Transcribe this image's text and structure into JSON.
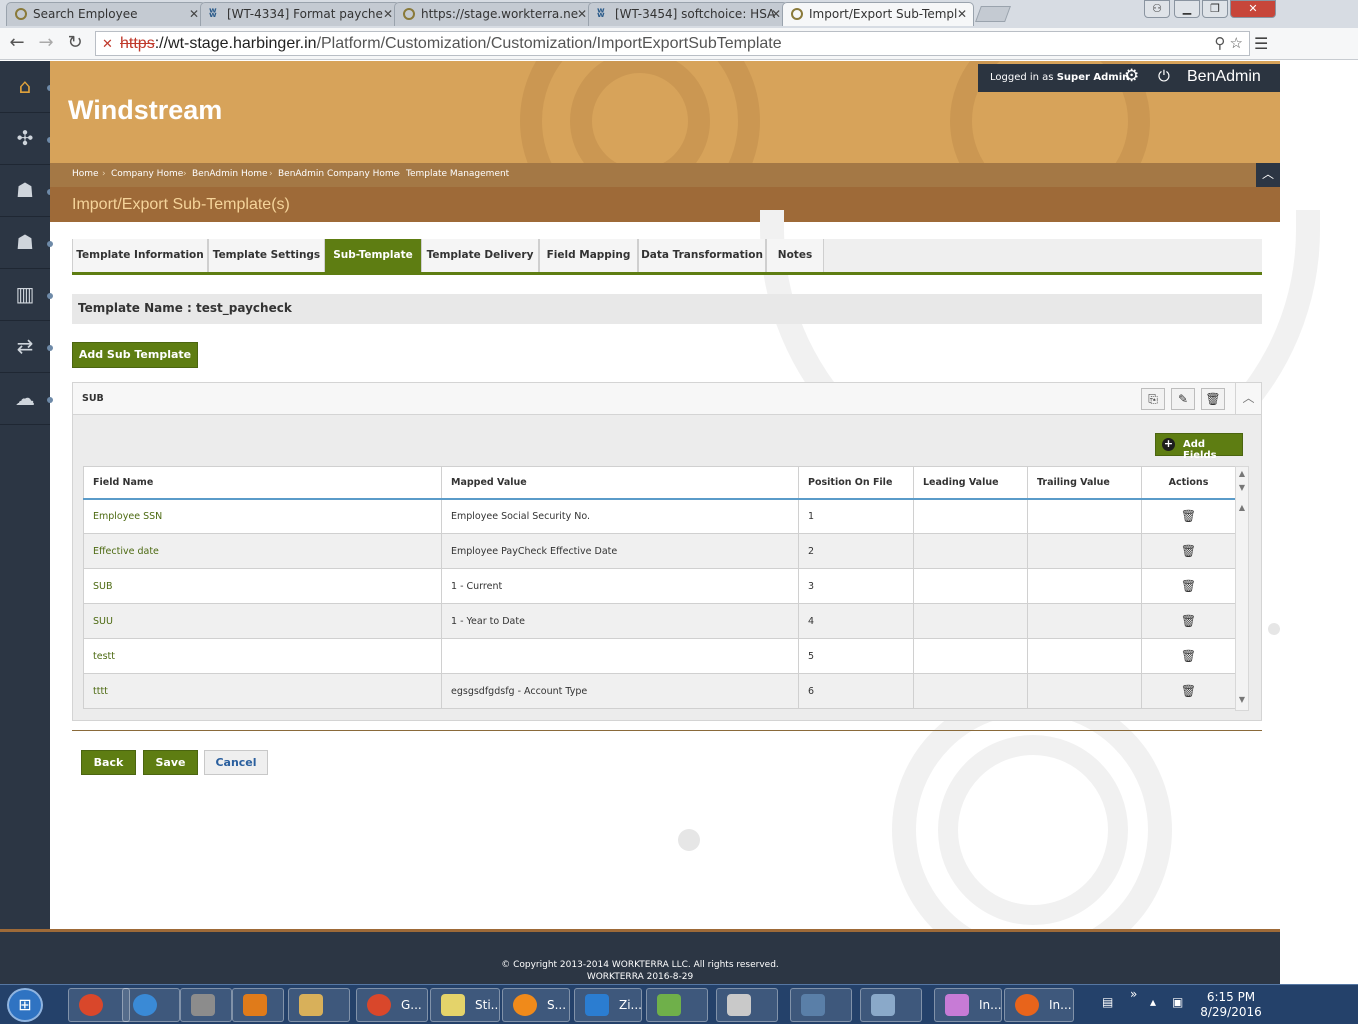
{
  "browser": {
    "tabs": [
      {
        "label": "Search Employee",
        "icon": "page-icon"
      },
      {
        "label": "[WT-4334] Format payche",
        "icon": "jira-icon"
      },
      {
        "label": "https://stage.workterra.ne",
        "icon": "page-icon"
      },
      {
        "label": "[WT-3454] softchoice: HSA",
        "icon": "jira-icon"
      },
      {
        "label": "Import/Export Sub-Templ",
        "icon": "page-icon"
      }
    ],
    "url_scheme": "https",
    "url_host": "://wt-stage.harbinger.in",
    "url_path": "/Platform/Customization/Customization/ImportExportSubTemplate"
  },
  "header": {
    "brand": "Windstream",
    "logged_in_prefix": "Logged in as",
    "logged_in_role": "Super Admin",
    "app_name": "BenAdmin",
    "accent_color": "#9e6a38"
  },
  "breadcrumb": [
    "Home",
    "Company Home",
    "BenAdmin Home",
    "BenAdmin Company Home",
    "Template Management"
  ],
  "page_title": "Import/Export Sub-Template(s)",
  "tabs": [
    {
      "label": "Template Information",
      "active": false
    },
    {
      "label": "Template Settings",
      "active": false
    },
    {
      "label": "Sub-Template",
      "active": true
    },
    {
      "label": "Template Delivery",
      "active": false
    },
    {
      "label": "Field Mapping",
      "active": false
    },
    {
      "label": "Data Transformation",
      "active": false
    },
    {
      "label": "Notes",
      "active": false
    }
  ],
  "template_name_label": "Template Name : test_paycheck",
  "add_sub_template_label": "Add Sub Template",
  "panel": {
    "title": "SUB",
    "add_fields_label": "Add Fields",
    "columns": [
      "Field Name",
      "Mapped Value",
      "Position On File",
      "Leading Value",
      "Trailing Value",
      "Actions"
    ],
    "rows": [
      {
        "field": "Employee SSN",
        "mapped": "Employee Social Security No.",
        "position": "1",
        "leading": "",
        "trailing": ""
      },
      {
        "field": "Effective date",
        "mapped": "Employee PayCheck Effective Date",
        "position": "2",
        "leading": "",
        "trailing": ""
      },
      {
        "field": "SUB",
        "mapped": "1 - Current",
        "position": "3",
        "leading": "",
        "trailing": ""
      },
      {
        "field": "SUU",
        "mapped": "1 - Year to Date",
        "position": "4",
        "leading": "",
        "trailing": ""
      },
      {
        "field": "testt",
        "mapped": "",
        "position": "5",
        "leading": "",
        "trailing": ""
      },
      {
        "field": "tttt",
        "mapped": "egsgsdfgdsfg - Account Type",
        "position": "6",
        "leading": "",
        "trailing": ""
      }
    ]
  },
  "actions": {
    "back": "Back",
    "save": "Save",
    "cancel": "Cancel"
  },
  "footer": {
    "copyright": "© Copyright 2013-2014 WORKTERRA LLC. All rights reserved.",
    "build": "WORKTERRA 2016-8-29"
  },
  "taskbar": {
    "apps": [
      {
        "label": "",
        "color": "#d9472b"
      },
      {
        "label": "",
        "color": "#3a8ad6"
      },
      {
        "label": "",
        "color": "#8c8c8c"
      },
      {
        "label": "",
        "color": "#e07b1a"
      },
      {
        "label": "",
        "color": "#d8b05a"
      },
      {
        "label": "G...",
        "color": "#d9472b"
      },
      {
        "label": "Sti...",
        "color": "#e4d36a"
      },
      {
        "label": "S...",
        "color": "#f08a1a"
      },
      {
        "label": "Zi...",
        "color": "#2b7dd1"
      },
      {
        "label": "",
        "color": "#6fb04a"
      },
      {
        "label": "",
        "color": "#c9c9c9"
      },
      {
        "label": "",
        "color": "#5a7fa8"
      },
      {
        "label": "",
        "color": "#8aa9c9"
      },
      {
        "label": "In...",
        "color": "#c77bd6"
      },
      {
        "label": "In...",
        "color": "#e8641b"
      }
    ],
    "time": "6:15 PM",
    "date": "8/29/2016"
  }
}
